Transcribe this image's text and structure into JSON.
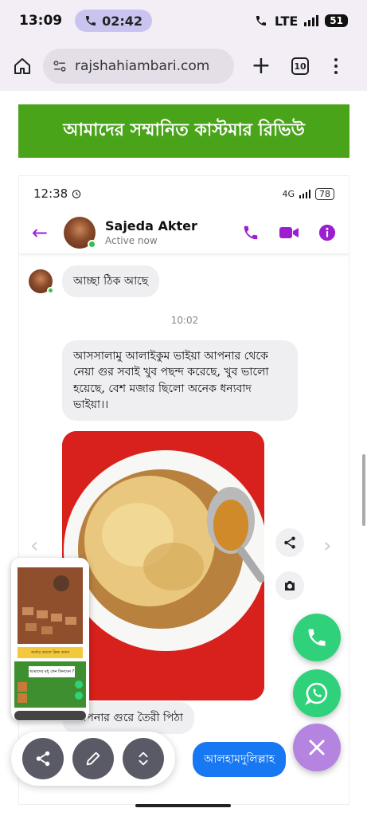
{
  "status_bar": {
    "time": "13:09",
    "call_time": "02:42",
    "network": "LTE",
    "battery": "51"
  },
  "browser": {
    "url": "rajshahiambari.com",
    "tab_count": "10"
  },
  "banner": {
    "title": "আমাদের সম্মানিত কাস্টমার রিভিউ",
    "color": "#4aa419"
  },
  "chat_screenshot": {
    "status_time": "12:38",
    "battery": "78",
    "network": "4G",
    "contact": {
      "name": "Sajeda Akter",
      "status": "Active now"
    },
    "messages": {
      "received_1": "আচ্ছা ঠিক আছে",
      "timestamp": "10:02",
      "received_2": "আসসালামু আলাইকুম ভাইয়া আপনার থেকে নেয়া গুর সবাই খুব পছন্দ করেছে, খুব ভালো হয়েছে,  বেশ মজার ছিলো অনেক ধন্যবাদ ভাইয়া।।",
      "received_3": "আপনার গুরে তৈরী পিঠা",
      "sent_1": "আলহামদুলিল্লাহ"
    },
    "accent_color": "#9b1fd1"
  },
  "floating": {
    "call_color": "#2fd27a",
    "whatsapp_color": "#2fd27a",
    "close_color": "#b583e0"
  },
  "thumbnail": {
    "label_1": "আমাদের মধু কেন কিনবেন ?",
    "label_2": "অর্ডার করতে ক্লিক করুন"
  }
}
